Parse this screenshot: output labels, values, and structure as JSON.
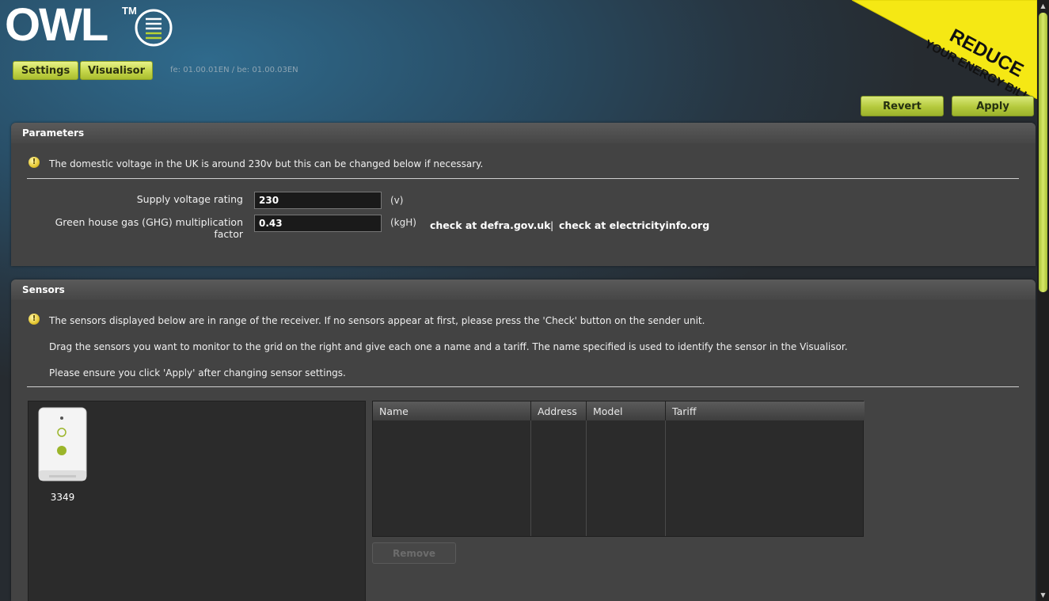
{
  "header": {
    "logo_text": "OWL",
    "trademark": "TM",
    "version": "fe: 01.00.01EN / be: 01.00.03EN",
    "nav": [
      {
        "label": "Settings"
      },
      {
        "label": "Visualisor"
      }
    ],
    "actions": {
      "revert_label": "Revert",
      "apply_label": "Apply"
    }
  },
  "banner": {
    "line1": "REDUCE",
    "line2": "YOUR ENERGY BILL",
    "color": "#f5e814"
  },
  "parameters": {
    "title": "Parameters",
    "info": "The domestic voltage in the UK is around 230v but this can be changed below if necessary.",
    "fields": [
      {
        "label": "Supply voltage rating",
        "value": "230",
        "unit": "(v)"
      },
      {
        "label": "Green house gas (GHG) multiplication factor",
        "value": "0.43",
        "unit": "(kgH)"
      }
    ],
    "links": {
      "defra": "check at defra.gov.uk",
      "separator": "|",
      "electricityinfo": "check at electricityinfo.org"
    }
  },
  "sensors": {
    "title": "Sensors",
    "info": [
      "The sensors displayed below are in range of the receiver. If no sensors appear at first, please press the 'Check' button on the sender unit.",
      "Drag the sensors you want to monitor to the grid on the right and give each one a name and a tariff. The name specified is used to identify the sensor in the Visualisor.",
      "Please ensure you click 'Apply' after changing sensor settings."
    ],
    "available": [
      {
        "id": "3349",
        "icon": "sensor-device-icon"
      }
    ],
    "grid_columns": [
      "Name",
      "Address",
      "Model",
      "Tariff"
    ],
    "remove_label": "Remove"
  },
  "colors": {
    "accent": "#c5d64a",
    "panel": "#434343",
    "background": "#2a3b48"
  }
}
